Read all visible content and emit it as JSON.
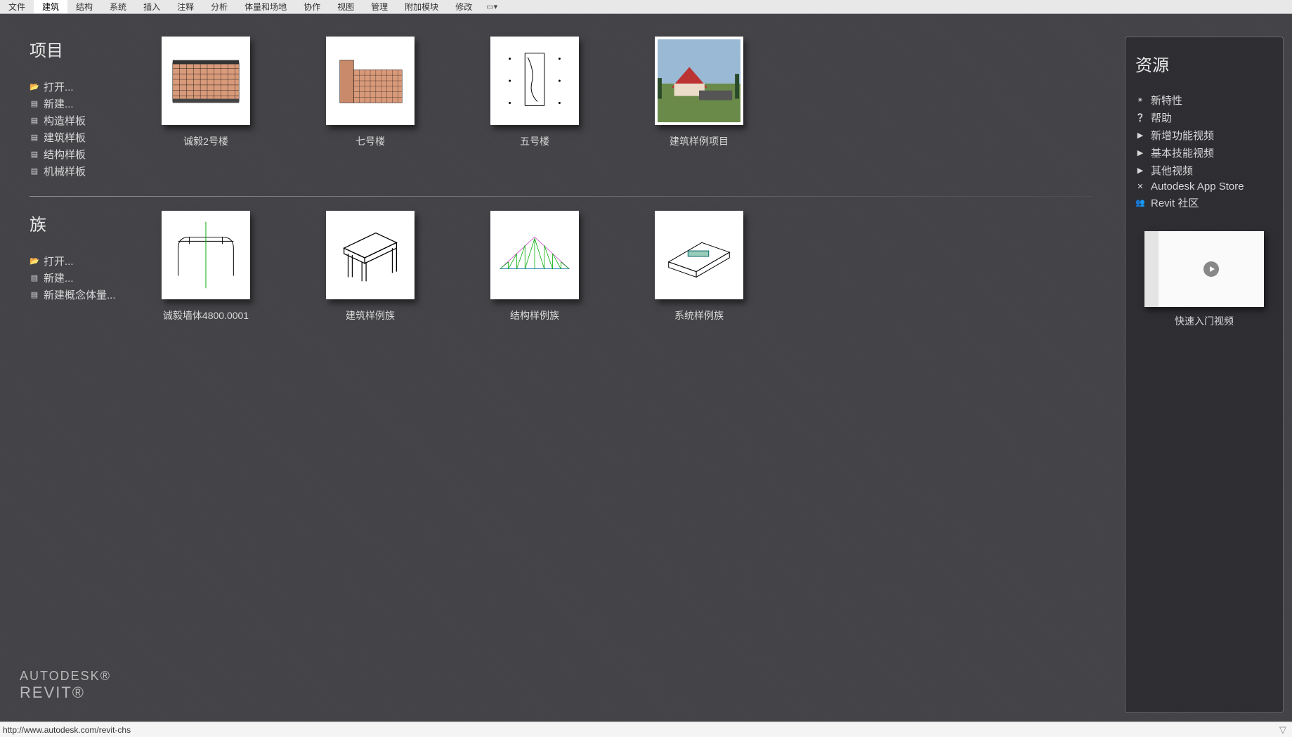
{
  "ribbon": {
    "tabs": [
      "文件",
      "建筑",
      "结构",
      "系统",
      "插入",
      "注释",
      "分析",
      "体量和场地",
      "协作",
      "视图",
      "管理",
      "附加模块",
      "修改"
    ],
    "active_index": 1
  },
  "projects": {
    "title": "项目",
    "links": [
      {
        "icon": "folder",
        "label": "打开..."
      },
      {
        "icon": "file",
        "label": "新建..."
      },
      {
        "icon": "file",
        "label": "构造样板"
      },
      {
        "icon": "file",
        "label": "建筑样板"
      },
      {
        "icon": "file",
        "label": "结构样板"
      },
      {
        "icon": "file",
        "label": "机械样板"
      }
    ],
    "items": [
      {
        "label": "诚毅2号楼"
      },
      {
        "label": "七号楼"
      },
      {
        "label": "五号楼"
      },
      {
        "label": "建筑样例项目"
      }
    ]
  },
  "families": {
    "title": "族",
    "links": [
      {
        "icon": "folder",
        "label": "打开..."
      },
      {
        "icon": "file",
        "label": "新建..."
      },
      {
        "icon": "file",
        "label": "新建概念体量..."
      }
    ],
    "items": [
      {
        "label": "诚毅墙体4800.0001"
      },
      {
        "label": "建筑样例族"
      },
      {
        "label": "结构样例族"
      },
      {
        "label": "系统样例族"
      }
    ]
  },
  "resources": {
    "title": "资源",
    "links": [
      {
        "icon": "star",
        "label": "新特性"
      },
      {
        "icon": "help",
        "label": "帮助"
      },
      {
        "icon": "play",
        "label": "新增功能视频"
      },
      {
        "icon": "play",
        "label": "基本技能视频"
      },
      {
        "icon": "play",
        "label": "其他视频"
      },
      {
        "icon": "x",
        "label": "Autodesk App Store"
      },
      {
        "icon": "group",
        "label": "Revit 社区"
      }
    ],
    "video_label": "快速入门视频"
  },
  "logo": {
    "line1": "AUTODESK®",
    "line2": "REVIT®"
  },
  "status": {
    "url": "http://www.autodesk.com/revit-chs"
  }
}
